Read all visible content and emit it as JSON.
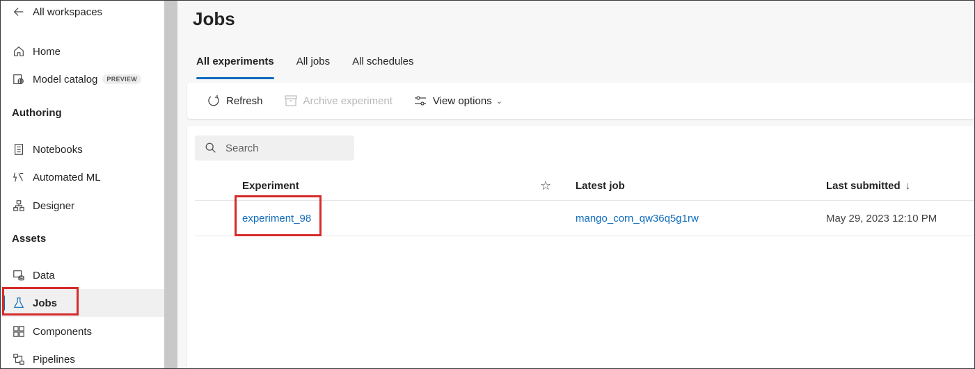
{
  "sidebar": {
    "back_label": "All workspaces",
    "items_top": [
      {
        "label": "Home",
        "icon": "home-icon"
      },
      {
        "label": "Model catalog",
        "icon": "model-catalog-icon",
        "badge": "PREVIEW"
      }
    ],
    "sections": [
      {
        "title": "Authoring",
        "items": [
          {
            "label": "Notebooks",
            "icon": "notebook-icon"
          },
          {
            "label": "Automated ML",
            "icon": "automated-ml-icon"
          },
          {
            "label": "Designer",
            "icon": "designer-icon"
          }
        ]
      },
      {
        "title": "Assets",
        "items": [
          {
            "label": "Data",
            "icon": "data-icon"
          },
          {
            "label": "Jobs",
            "icon": "flask-icon",
            "active": true
          },
          {
            "label": "Components",
            "icon": "components-icon"
          },
          {
            "label": "Pipelines",
            "icon": "pipelines-icon"
          }
        ]
      }
    ]
  },
  "main": {
    "title": "Jobs",
    "tabs": [
      {
        "label": "All experiments",
        "selected": true
      },
      {
        "label": "All jobs"
      },
      {
        "label": "All schedules"
      }
    ],
    "toolbar": {
      "refresh": "Refresh",
      "archive": "Archive experiment",
      "view_options": "View options"
    },
    "search": {
      "placeholder": "Search"
    },
    "table": {
      "columns": {
        "experiment": "Experiment",
        "latest_job": "Latest job",
        "last_submitted": "Last submitted"
      },
      "sort_indicator": "↓",
      "rows": [
        {
          "experiment": "experiment_98",
          "latest_job": "mango_corn_qw36q5g1rw",
          "last_submitted": "May 29, 2023 12:10 PM"
        }
      ]
    }
  },
  "colors": {
    "accent": "#0f6cbd",
    "highlight": "#d62a2a",
    "divider": "#c8c8c8"
  }
}
